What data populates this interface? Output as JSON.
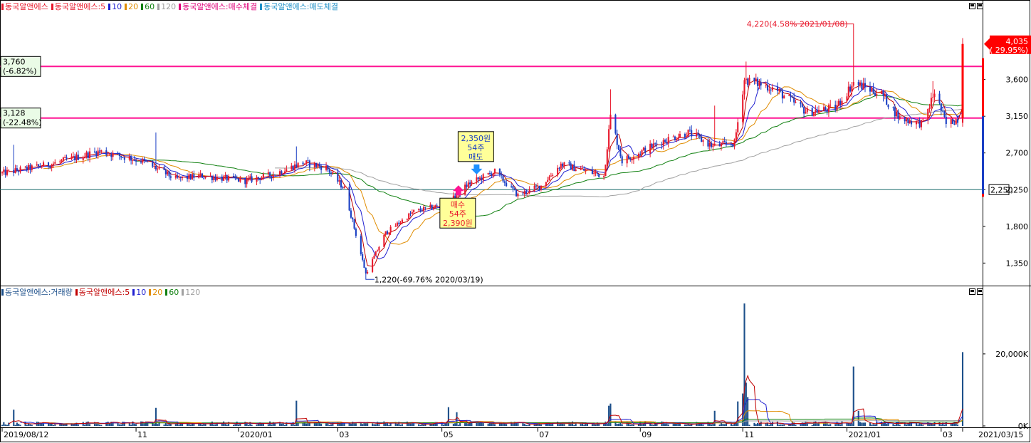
{
  "colors": {
    "up": "#e8192c",
    "down": "#1a3fc4",
    "ma5": "#c00000",
    "ma10": "#2020d0",
    "ma20": "#e08c00",
    "ma60": "#108010",
    "ma120": "#a0a0a0",
    "hline": "#ff1493",
    "support": "#207070",
    "volume": "#1c4f8a",
    "tag_fill": "#ffff99",
    "current": "#ff0000"
  },
  "price_legend": [
    {
      "text": "동국알앤에스",
      "color": "#e8192c"
    },
    {
      "text": "동국알앤에스:5",
      "color": "#e8192c"
    },
    {
      "text": "10",
      "color": "#2020d0"
    },
    {
      "text": "20",
      "color": "#e08c00"
    },
    {
      "text": "60",
      "color": "#108010"
    },
    {
      "text": "120",
      "color": "#a0a0a0"
    },
    {
      "text": "동국알앤에스:매수체결",
      "color": "#e0007a"
    },
    {
      "text": "동국알앤에스:매도체결",
      "color": "#1e90c8"
    }
  ],
  "volume_legend": [
    {
      "text": "동국알앤에스:거래량",
      "color": "#1c4f8a"
    },
    {
      "text": "동국알앤에스:5",
      "color": "#c00000"
    },
    {
      "text": "10",
      "color": "#2020d0"
    },
    {
      "text": "20",
      "color": "#e08c00"
    },
    {
      "text": "60",
      "color": "#108010"
    },
    {
      "text": "120",
      "color": "#a0a0a0"
    }
  ],
  "chart_data": [
    {
      "type": "candlestick",
      "title": "",
      "ylim": [
        1100,
        4400
      ],
      "yticks": [
        1350,
        1800,
        2250,
        2700,
        3150,
        3600
      ],
      "ytick_labels": [
        "1,350",
        "1,800",
        "2,250",
        "2,700",
        "3,150",
        "3,600"
      ],
      "x_range": [
        "2019-08-12",
        "2021-03-15"
      ],
      "x_ticks": [
        {
          "date": "2019-08-12",
          "label": "2019/08/12"
        },
        {
          "date": "2019-11-01",
          "label": "11"
        },
        {
          "date": "2020-01-02",
          "label": "2020/01"
        },
        {
          "date": "2020-03-02",
          "label": "03"
        },
        {
          "date": "2020-05-04",
          "label": "05"
        },
        {
          "date": "2020-07-01",
          "label": "07"
        },
        {
          "date": "2020-09-01",
          "label": "09"
        },
        {
          "date": "2020-11-02",
          "label": "11"
        },
        {
          "date": "2021-01-04",
          "label": "2021/01"
        },
        {
          "date": "2021-03-02",
          "label": "03"
        },
        {
          "date": "2021-03-15",
          "label": "2021/03/15"
        }
      ],
      "control_points": [
        [
          "2019-08-12",
          2450
        ],
        [
          "2019-09-10",
          2560
        ],
        [
          "2019-10-10",
          2720
        ],
        [
          "2019-11-05",
          2600
        ],
        [
          "2019-11-25",
          2380
        ],
        [
          "2019-12-10",
          2420
        ],
        [
          "2020-01-06",
          2360
        ],
        [
          "2020-01-22",
          2430
        ],
        [
          "2020-02-10",
          2580
        ],
        [
          "2020-02-24",
          2520
        ],
        [
          "2020-03-06",
          2260
        ],
        [
          "2020-03-19",
          1220
        ],
        [
          "2020-03-31",
          1720
        ],
        [
          "2020-04-17",
          1980
        ],
        [
          "2020-05-08",
          2080
        ],
        [
          "2020-05-20",
          2320
        ],
        [
          "2020-06-05",
          2470
        ],
        [
          "2020-06-19",
          2180
        ],
        [
          "2020-07-03",
          2300
        ],
        [
          "2020-07-15",
          2560
        ],
        [
          "2020-08-10",
          2420
        ],
        [
          "2020-08-14",
          3150
        ],
        [
          "2020-08-21",
          2600
        ],
        [
          "2020-09-15",
          2850
        ],
        [
          "2020-09-30",
          2950
        ],
        [
          "2020-10-15",
          2780
        ],
        [
          "2020-10-28",
          2820
        ],
        [
          "2020-11-03",
          3600
        ],
        [
          "2020-11-20",
          3500
        ],
        [
          "2020-12-11",
          3200
        ],
        [
          "2020-12-28",
          3250
        ],
        [
          "2021-01-08",
          3560
        ],
        [
          "2021-01-25",
          3420
        ],
        [
          "2021-02-05",
          3120
        ],
        [
          "2021-02-19",
          3060
        ],
        [
          "2021-02-26",
          3450
        ],
        [
          "2021-03-05",
          3050
        ],
        [
          "2021-03-12",
          3120
        ],
        [
          "2021-03-15",
          4035
        ]
      ],
      "spikes": [
        [
          "2019-08-19",
          2800
        ],
        [
          "2019-11-13",
          2950
        ],
        [
          "2020-02-06",
          2780
        ],
        [
          "2020-08-14",
          3480
        ],
        [
          "2020-10-16",
          3280
        ],
        [
          "2020-11-04",
          3820
        ],
        [
          "2021-01-08",
          4220
        ],
        [
          "2021-02-25",
          3580
        ]
      ],
      "horizontal_lines": [
        {
          "value": 3760,
          "label": "3,760",
          "pct": "(-6.82%)"
        },
        {
          "value": 3128,
          "label": "3,128",
          "pct": "(-22.48%)"
        }
      ],
      "support_line": {
        "value": 2250,
        "label": "2,250"
      },
      "current": {
        "value": 4035,
        "label": "4,035",
        "pct": "( 29.95%)"
      },
      "high": {
        "date": "2021-01-08",
        "value": 4220,
        "text": "4,220(4.58% 2021/01/08)"
      },
      "low": {
        "date": "2020-03-19",
        "value": 1220,
        "text": "1,220(-69.76% 2020/03/19)"
      },
      "trade_sell": {
        "date": "2020-05-25",
        "value": 2350,
        "lines": [
          "2,350원",
          "54주",
          "매도"
        ]
      },
      "trade_buy": {
        "date": "2020-05-14",
        "value": 2390,
        "lines": [
          "매수",
          "54주",
          "2,390원"
        ]
      }
    },
    {
      "type": "bar",
      "title": "",
      "ylim": [
        0,
        36000
      ],
      "yticks": [
        0,
        20000
      ],
      "ytick_labels": [
        "0K",
        "20,000K"
      ],
      "base_range": [
        250,
        1250
      ],
      "spikes": [
        [
          "2019-08-19",
          4500
        ],
        [
          "2019-11-13",
          5000
        ],
        [
          "2020-02-06",
          7000
        ],
        [
          "2020-05-08",
          5200
        ],
        [
          "2020-05-13",
          3800
        ],
        [
          "2020-08-13",
          5600
        ],
        [
          "2020-08-14",
          6200
        ],
        [
          "2020-10-16",
          4200
        ],
        [
          "2020-10-30",
          6800
        ],
        [
          "2020-11-02",
          9000
        ],
        [
          "2020-11-03",
          34000
        ],
        [
          "2020-11-04",
          12000
        ],
        [
          "2020-11-05",
          8000
        ],
        [
          "2021-01-08",
          16500
        ],
        [
          "2021-01-11",
          4200
        ],
        [
          "2021-03-15",
          20500
        ]
      ]
    }
  ]
}
